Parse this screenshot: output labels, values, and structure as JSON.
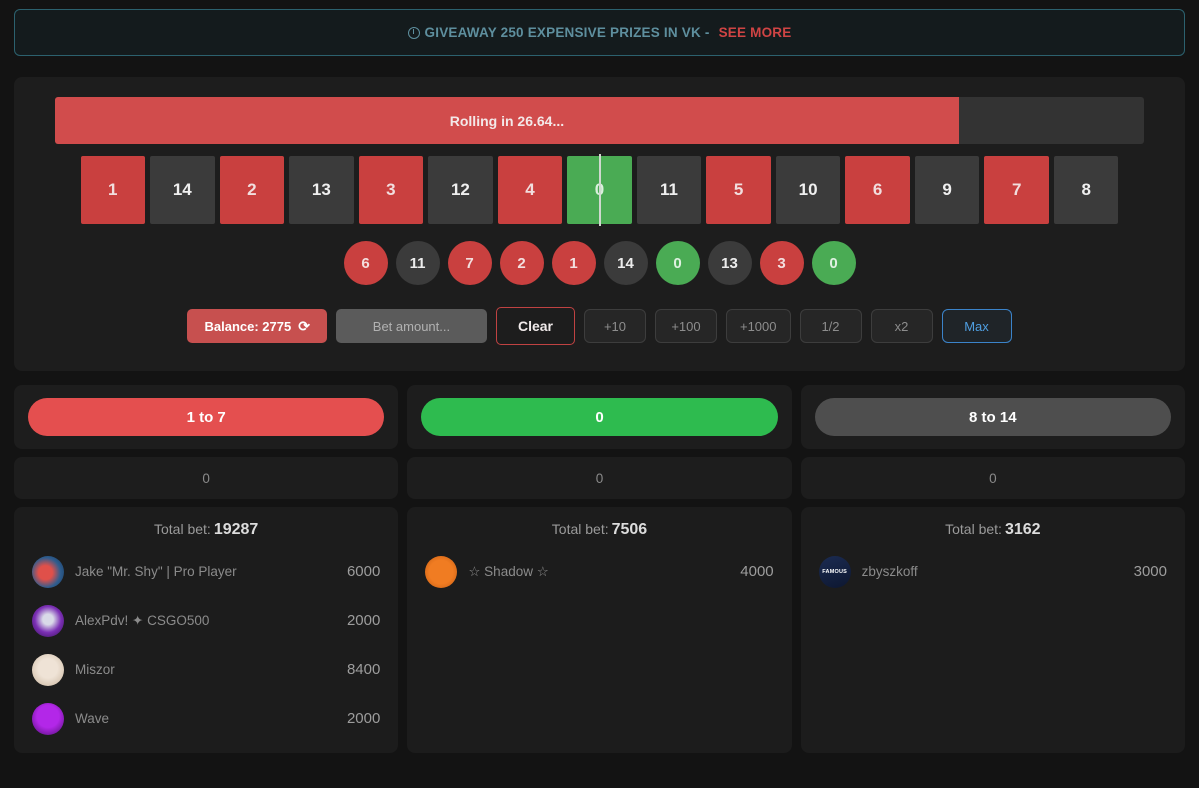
{
  "banner": {
    "icon": "clock-icon",
    "text": "GIVEAWAY 250 EXPENSIVE PRIZES IN VK -",
    "link_label": "SEE MORE",
    "text_color": "#5e8f9e",
    "link_color": "#d04444",
    "border_color": "#2c616e"
  },
  "game": {
    "progress_label": "Rolling in 26.64...",
    "progress_percent": 83,
    "reel": [
      {
        "value": "1",
        "color": "red"
      },
      {
        "value": "14",
        "color": "gray"
      },
      {
        "value": "2",
        "color": "red"
      },
      {
        "value": "13",
        "color": "gray"
      },
      {
        "value": "3",
        "color": "red"
      },
      {
        "value": "12",
        "color": "gray"
      },
      {
        "value": "4",
        "color": "red"
      },
      {
        "value": "0",
        "color": "green"
      },
      {
        "value": "11",
        "color": "gray"
      },
      {
        "value": "5",
        "color": "red"
      },
      {
        "value": "10",
        "color": "gray"
      },
      {
        "value": "6",
        "color": "red"
      },
      {
        "value": "9",
        "color": "gray"
      },
      {
        "value": "7",
        "color": "red"
      },
      {
        "value": "8",
        "color": "gray"
      }
    ],
    "history": [
      {
        "value": "6",
        "color": "red"
      },
      {
        "value": "11",
        "color": "gray"
      },
      {
        "value": "7",
        "color": "red"
      },
      {
        "value": "2",
        "color": "red"
      },
      {
        "value": "1",
        "color": "red"
      },
      {
        "value": "14",
        "color": "gray"
      },
      {
        "value": "0",
        "color": "green"
      },
      {
        "value": "13",
        "color": "gray"
      },
      {
        "value": "3",
        "color": "red"
      },
      {
        "value": "0",
        "color": "green"
      }
    ],
    "colors": {
      "red": "#c9403f",
      "gray": "#3b3b3b",
      "green": "#4aab54",
      "progress_fill": "#d14c4c",
      "progress_track": "#333333"
    }
  },
  "controls": {
    "balance_label": "Balance: 2775",
    "refresh_icon": "refresh-icon",
    "bet_placeholder": "Bet amount...",
    "bet_value": "",
    "clear_label": "Clear",
    "chips": [
      "+10",
      "+100",
      "+1000",
      "1/2",
      "x2"
    ],
    "max_label": "Max"
  },
  "columns": [
    {
      "bet_label": "1 to 7",
      "bet_color": "red",
      "my_bet": "0",
      "total_bet_label": "Total bet:",
      "total_bet": "19287",
      "players": [
        {
          "name": "Jake \"Mr. Shy\" | Pro Player",
          "amount": "6000",
          "avatar": "av-jake",
          "avatar_text": ""
        },
        {
          "name": "AlexPdv! ✦ CSGO500",
          "amount": "2000",
          "avatar": "av-alex",
          "avatar_text": ""
        },
        {
          "name": "Miszor",
          "amount": "8400",
          "avatar": "av-miszor",
          "avatar_text": ""
        },
        {
          "name": "Wave",
          "amount": "2000",
          "avatar": "av-wave",
          "avatar_text": ""
        }
      ]
    },
    {
      "bet_label": "0",
      "bet_color": "green",
      "my_bet": "0",
      "total_bet_label": "Total bet:",
      "total_bet": "7506",
      "players": [
        {
          "name": "☆ Shadow ☆",
          "amount": "4000",
          "avatar": "av-shadow",
          "avatar_text": ""
        }
      ]
    },
    {
      "bet_label": "8 to 14",
      "bet_color": "gray",
      "my_bet": "0",
      "total_bet_label": "Total bet:",
      "total_bet": "3162",
      "players": [
        {
          "name": "zbyszkoff",
          "amount": "3000",
          "avatar": "av-famous",
          "avatar_text": "FAMOUS"
        }
      ]
    }
  ]
}
